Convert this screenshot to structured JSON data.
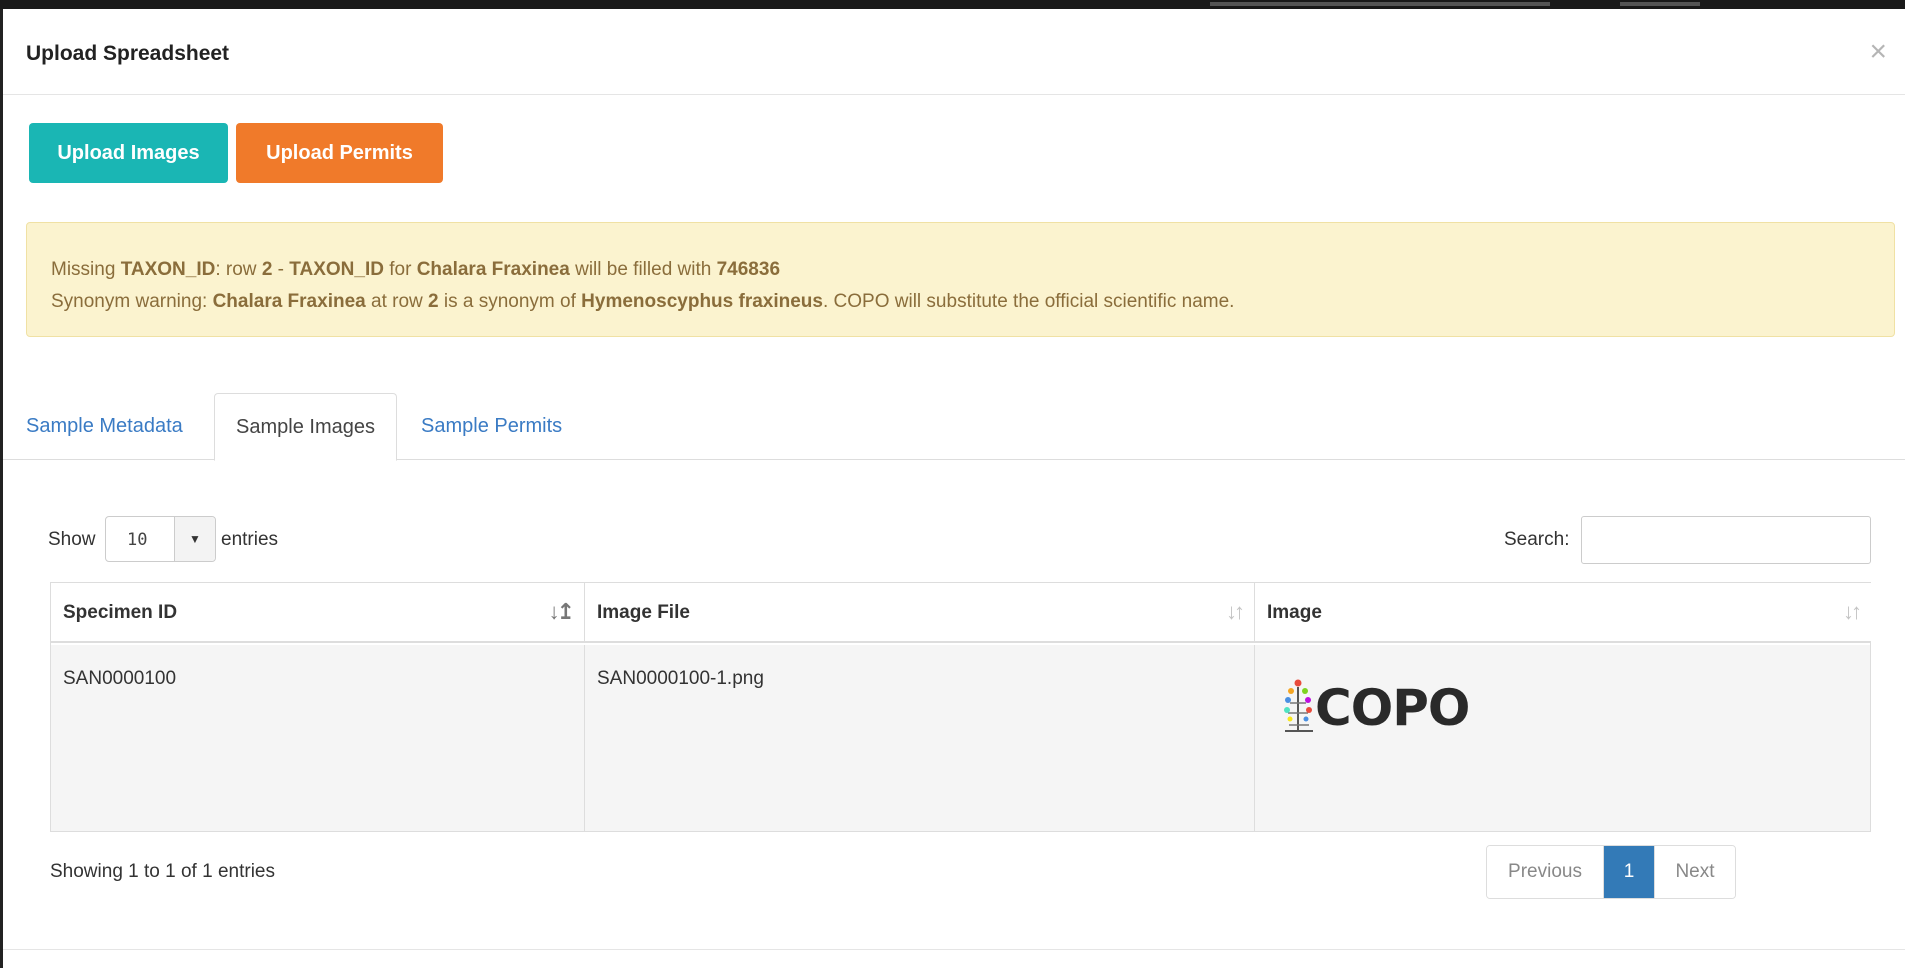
{
  "modal": {
    "title": "Upload Spreadsheet",
    "close_label": "×"
  },
  "actions": {
    "upload_images_label": "Upload Images",
    "upload_permits_label": "Upload Permits",
    "colors": {
      "teal": "#1ab6b4",
      "orange": "#f07a2a"
    }
  },
  "alert": {
    "line1": {
      "p1": "Missing ",
      "b1": "TAXON_ID",
      "p2": ": row ",
      "b2": "2",
      "p3": " - ",
      "b3": "TAXON_ID",
      "p4": " for ",
      "b4": "Chalara Fraxinea",
      "p5": " will be filled with ",
      "b5": "746836"
    },
    "line2": {
      "p1": "Synonym warning: ",
      "b1": "Chalara Fraxinea",
      "p2": " at row ",
      "b2": "2",
      "p3": " is a synonym of ",
      "b3": "Hymenoscyphus fraxineus",
      "p4": ". COPO will substitute the official scientific name."
    }
  },
  "tabs": [
    {
      "label": "Sample Metadata",
      "active": false
    },
    {
      "label": "Sample Images",
      "active": true
    },
    {
      "label": "Sample Permits",
      "active": false
    }
  ],
  "table_controls": {
    "show_label": "Show",
    "page_length": "10",
    "caret_icon": "caret-down-icon",
    "entries_label": "entries",
    "search_label": "Search:",
    "search_value": ""
  },
  "table": {
    "columns": [
      {
        "label": "Specimen ID",
        "sort_icon": "sort-asc-icon"
      },
      {
        "label": "Image File",
        "sort_icon": "sort-both-icon"
      },
      {
        "label": "Image",
        "sort_icon": "sort-both-icon"
      }
    ],
    "rows": [
      {
        "specimen_id": "SAN0000100",
        "image_file": "SAN0000100-1.png",
        "image_logo_text": "COPO"
      }
    ]
  },
  "footer": {
    "info": "Showing 1 to 1 of 1 entries",
    "previous_label": "Previous",
    "current_page": "1",
    "next_label": "Next",
    "active_page_color": "#337ab7"
  }
}
